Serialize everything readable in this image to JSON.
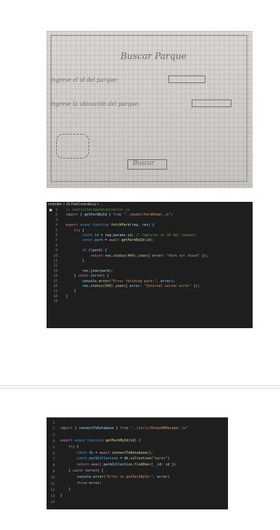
{
  "photo": {
    "title": "Buscar Parque",
    "line1": "Ingrese el id del parque:",
    "line2": "Ingrese la ubicación del parque:",
    "button": "Buscar"
  },
  "editor1": {
    "breadcrumb": "controller > JS ParkController.js > ...",
    "line_numbers": "1\n2\n3\n4\n5\n6\n7\n8\n9\n10\n11\n12\n13\n14\n15\n16\n17\n18\n19",
    "lines": [
      "// controller/parkController.js",
      "import { getParkById } from \"../model/ParkModel.js\";",
      "",
      "export async function fetchPark(req, res) {",
      "    try {",
      "        const id = req.params.id; // Capturar el ID del request",
      "        const park = await getParkById(id);",
      "",
      "        if (!park) {",
      "            return res.status(404).json({ error: \"Park not found\" });",
      "        }",
      "",
      "        res.json(park);",
      "    } catch (error) {",
      "        console.error(\"Error fetching park:\", error);",
      "        res.status(500).json({ error: \"Internal server error\" });",
      "    }",
      "}",
      ""
    ]
  },
  "editor2": {
    "line_numbers": "1\n2\n3\n4\n5\n6\n7\n8\n9\n10\n11\n12\n13\n14",
    "lines": [
      "",
      "import { connectToDatabase } from \"../utils/MongoDBManager.js\"",
      "",
      "export async function getParkById(id) {",
      "    try {",
      "        const db = await connectToDatabase();",
      "        const parkCollection = db.collection(\"parks\")",
      "        return await parkCollection.findOne({ _id: id })",
      "    } catch (error) {",
      "        console.error(\"Error in getParkById:\", error)",
      "        throw error;",
      "    }",
      "}",
      ""
    ]
  }
}
